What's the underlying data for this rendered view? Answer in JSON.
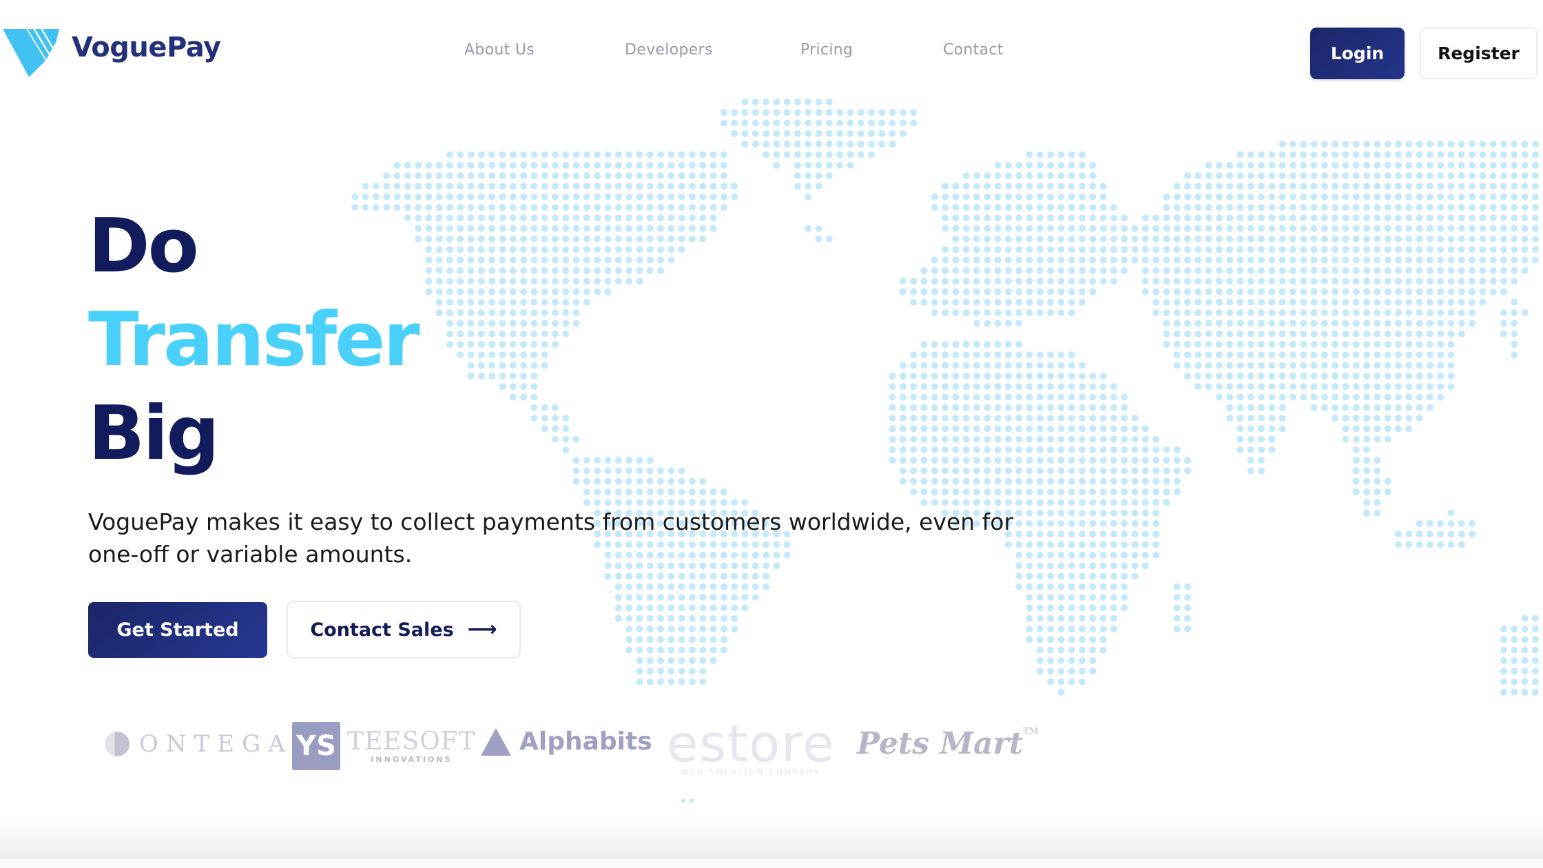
{
  "brand": {
    "name": "VoguePay",
    "logo_icon": "voguepay-v-logo-icon",
    "primary_color": "#1c2669",
    "accent_color": "#49d0fb",
    "map_dot_color": "#c4e9fb"
  },
  "nav": {
    "items": [
      {
        "label": "About Us"
      },
      {
        "label": "Developers"
      },
      {
        "label": "Pricing"
      },
      {
        "label": "Contact"
      }
    ],
    "login_label": "Login",
    "register_label": "Register"
  },
  "hero": {
    "headline": [
      {
        "text": "Do",
        "tone": "dark"
      },
      {
        "text": "Transfer",
        "tone": "accent"
      },
      {
        "text": "Big",
        "tone": "dark"
      }
    ],
    "subtitle": "VoguePay makes it easy to collect payments from customers worldwide, even for one-off or variable amounts.",
    "get_started_label": "Get Started",
    "contact_sales_label": "Contact Sales",
    "contact_sales_icon": "arrow-right-icon",
    "background_graphic": "dotted-world-map"
  },
  "partners": [
    {
      "name": "ONTEGA"
    },
    {
      "name": "TEESOFT",
      "mark": "YS",
      "tagline": "INNOVATIONS"
    },
    {
      "name": "Alphabits"
    },
    {
      "name": "estore",
      "tagline": "WEB SOLUTION COMPANY"
    },
    {
      "name": "Pets Mart",
      "suffix": "TM"
    }
  ]
}
